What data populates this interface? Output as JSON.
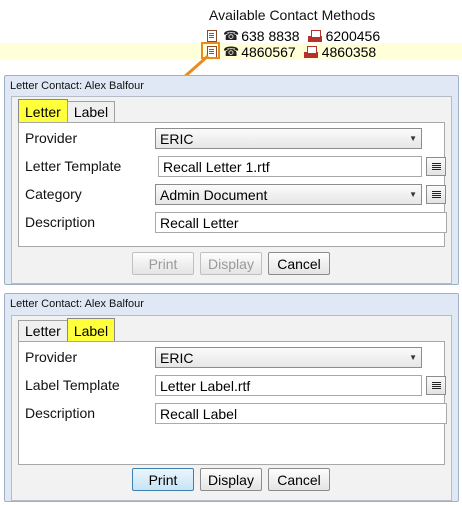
{
  "contacts": {
    "header": "Available Contact Methods",
    "rows": [
      {
        "phone": "638 8838",
        "fax": "6200456"
      },
      {
        "phone": "4860567",
        "fax": "4860358"
      }
    ]
  },
  "letter_dialog": {
    "title": "Letter Contact: Alex Balfour",
    "tabs": [
      "Letter",
      "Label"
    ],
    "active_tab": "Letter",
    "provider_label": "Provider",
    "provider_value": "ERIC",
    "template_label": "Letter Template",
    "template_value": "Recall Letter 1.rtf",
    "category_label": "Category",
    "category_value": "Admin Document",
    "description_label": "Description",
    "description_value": "Recall Letter",
    "buttons": {
      "print": "Print",
      "display": "Display",
      "cancel": "Cancel"
    }
  },
  "label_dialog": {
    "title": "Letter Contact: Alex Balfour",
    "tabs": [
      "Letter",
      "Label"
    ],
    "active_tab": "Label",
    "provider_label": "Provider",
    "provider_value": "ERIC",
    "template_label": "Label Template",
    "template_value": "Letter Label.rtf",
    "description_label": "Description",
    "description_value": "Recall Label",
    "buttons": {
      "print": "Print",
      "display": "Display",
      "cancel": "Cancel"
    }
  },
  "colors": {
    "highlight_yellow": "#ffff3c",
    "callout_orange": "#e98b1f",
    "selected_row": "#ffffd8",
    "dialog_bg": "#dfe8f4"
  },
  "icons": [
    "letter-icon",
    "phone-icon",
    "fax-icon",
    "dropdown-caret-icon",
    "browse-list-icon"
  ]
}
